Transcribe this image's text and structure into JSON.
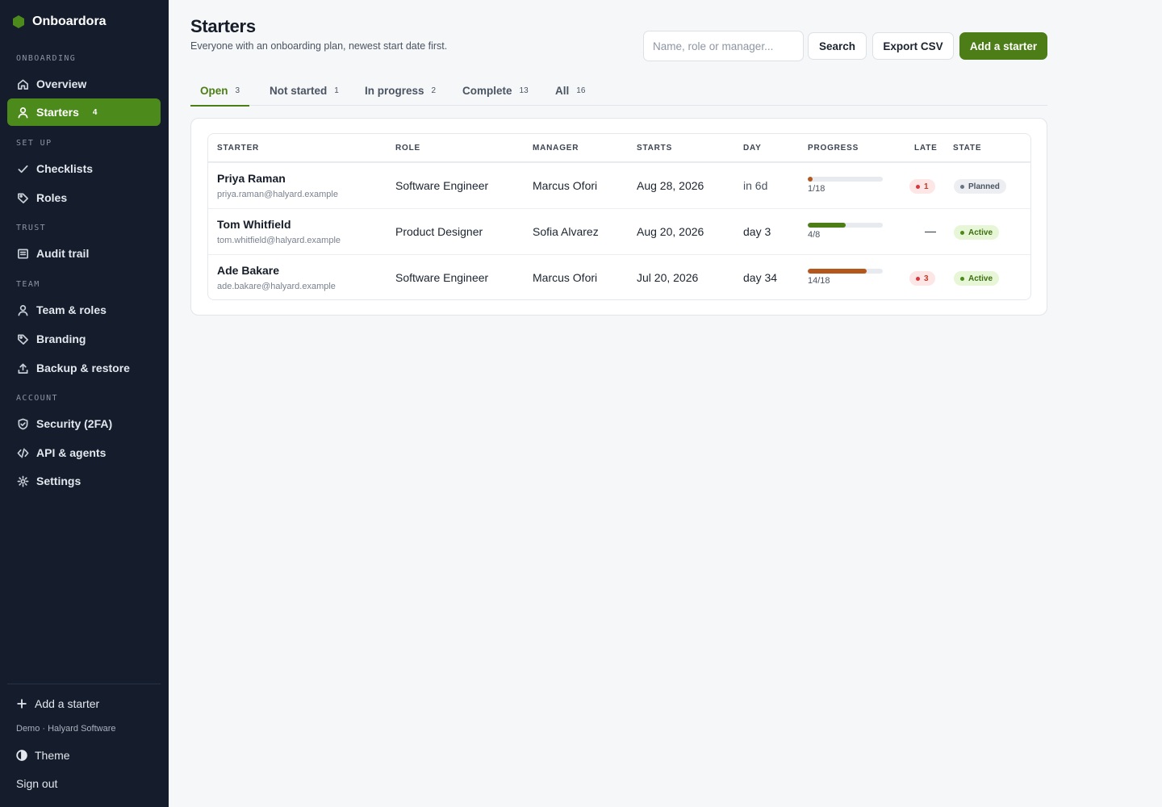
{
  "brand": {
    "name": "Onboardora",
    "color": "#4c8a1b"
  },
  "sidebar": {
    "sections": [
      {
        "label": "ONBOARDING"
      },
      {
        "label": "SET UP"
      },
      {
        "label": "TRUST"
      },
      {
        "label": "TEAM"
      },
      {
        "label": "ACCOUNT"
      }
    ],
    "items": [
      {
        "label": "Overview",
        "icon": "home-icon"
      },
      {
        "label": "Starters",
        "icon": "user-icon",
        "badge": "4",
        "active": true
      },
      {
        "label": "Checklists",
        "icon": "check-icon"
      },
      {
        "label": "Roles",
        "icon": "tag-icon"
      },
      {
        "label": "Audit trail",
        "icon": "list-icon"
      },
      {
        "label": "Team & roles",
        "icon": "user-icon"
      },
      {
        "label": "Branding",
        "icon": "tag-icon"
      },
      {
        "label": "Backup & restore",
        "icon": "upload-icon"
      },
      {
        "label": "Security (2FA)",
        "icon": "shield-icon"
      },
      {
        "label": "API & agents",
        "icon": "code-icon"
      },
      {
        "label": "Settings",
        "icon": "gear-icon"
      }
    ],
    "footer": {
      "add_label": "Add a starter",
      "demo_text": "Demo · Halyard Software",
      "theme_label": "Theme",
      "signout_label": "Sign out"
    }
  },
  "header": {
    "title": "Starters",
    "subtitle": "Everyone with an onboarding plan, newest start date first.",
    "search_placeholder": "Name, role or manager...",
    "search_button": "Search",
    "export_button": "Export CSV",
    "add_button": "Add a starter"
  },
  "tabs": [
    {
      "label": "Open",
      "count": "3",
      "active": true
    },
    {
      "label": "Not started",
      "count": "1"
    },
    {
      "label": "In progress",
      "count": "2"
    },
    {
      "label": "Complete",
      "count": "13"
    },
    {
      "label": "All",
      "count": "16"
    }
  ],
  "table": {
    "columns": [
      "STARTER",
      "ROLE",
      "MANAGER",
      "STARTS",
      "DAY",
      "PROGRESS",
      "LATE",
      "STATE"
    ],
    "rows": [
      {
        "name": "Priya Raman",
        "email": "priya.raman@halyard.example",
        "role": "Software Engineer",
        "manager": "Marcus Ofori",
        "starts": "Aug 28, 2026",
        "day": "in 6d",
        "progress_label": "1/18",
        "progress": 0.055,
        "progress_color": "#b5561c",
        "late": "1",
        "state": "Planned"
      },
      {
        "name": "Tom Whitfield",
        "email": "tom.whitfield@halyard.example",
        "role": "Product Designer",
        "manager": "Sofia Alvarez",
        "starts": "Aug 20, 2026",
        "day": "day 3",
        "progress_label": "4/8",
        "progress": 0.5,
        "progress_color": "#4c7d16",
        "late": "—",
        "state": "Active"
      },
      {
        "name": "Ade Bakare",
        "email": "ade.bakare@halyard.example",
        "role": "Software Engineer",
        "manager": "Marcus Ofori",
        "starts": "Jul 20, 2026",
        "day": "day 34",
        "progress_label": "14/18",
        "progress": 0.78,
        "progress_color": "#b5561c",
        "late": "3",
        "state": "Active"
      }
    ]
  }
}
